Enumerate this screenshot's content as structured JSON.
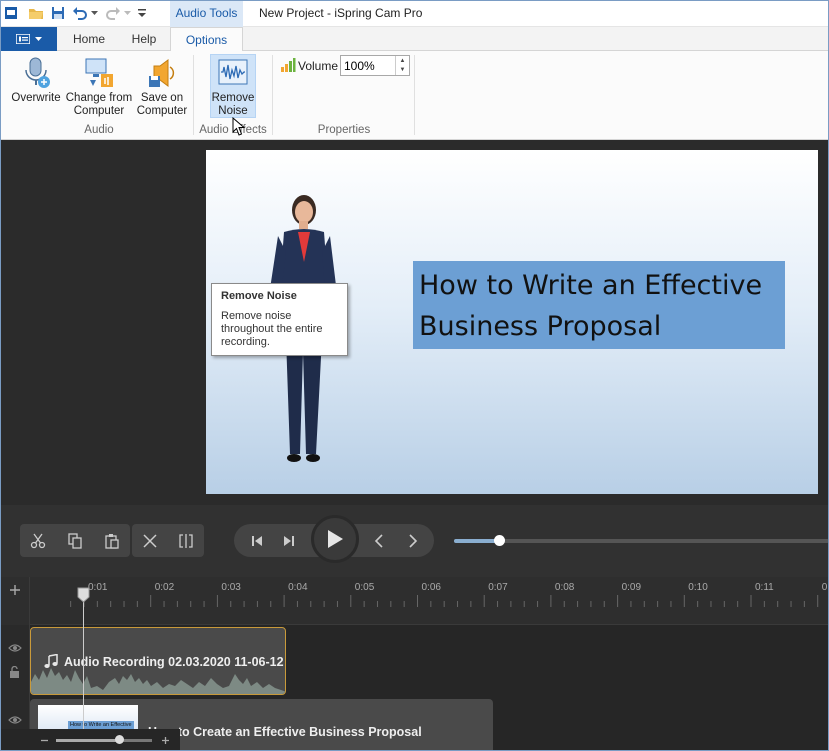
{
  "titlebar": {
    "context_tab": "Audio Tools",
    "title": "New Project - iSpring Cam Pro"
  },
  "tabs": [
    {
      "label": "Home"
    },
    {
      "label": "Help"
    },
    {
      "label": "Options"
    }
  ],
  "ribbon": {
    "overwrite": "Overwrite",
    "change_from_computer_1": "Change from",
    "change_from_computer_2": "Computer",
    "save_on_computer_1": "Save on",
    "save_on_computer_2": "Computer",
    "group_audio": "Audio",
    "remove_noise_1": "Remove",
    "remove_noise_2": "Noise",
    "group_audio_effects": "Audio Effects",
    "volume_label": "Volume",
    "volume_value": "100%",
    "group_properties": "Properties"
  },
  "tooltip": {
    "title": "Remove Noise",
    "description": "Remove noise throughout the entire recording."
  },
  "slide": {
    "title": "How to Write an Effective Business Proposal",
    "thumb_title": "How to Write an Effective"
  },
  "player": {
    "progress": 0.12
  },
  "timeline": {
    "ticks": [
      "0:01",
      "0:02",
      "0:03",
      "0:04",
      "0:05",
      "0:06",
      "0:07",
      "0:08",
      "0:09",
      "0:10",
      "0:11",
      "0:1"
    ],
    "audio_clip": "Audio Recording 02.03.2020 11-06-12",
    "video_clip": "How to Create an Effective Business Proposal",
    "zoom_level": 0.66
  },
  "colors": {
    "accent": "#1a5ba8",
    "audio_clip_border": "#c99a3a",
    "slide_title_highlight": "#6c9fd4"
  }
}
